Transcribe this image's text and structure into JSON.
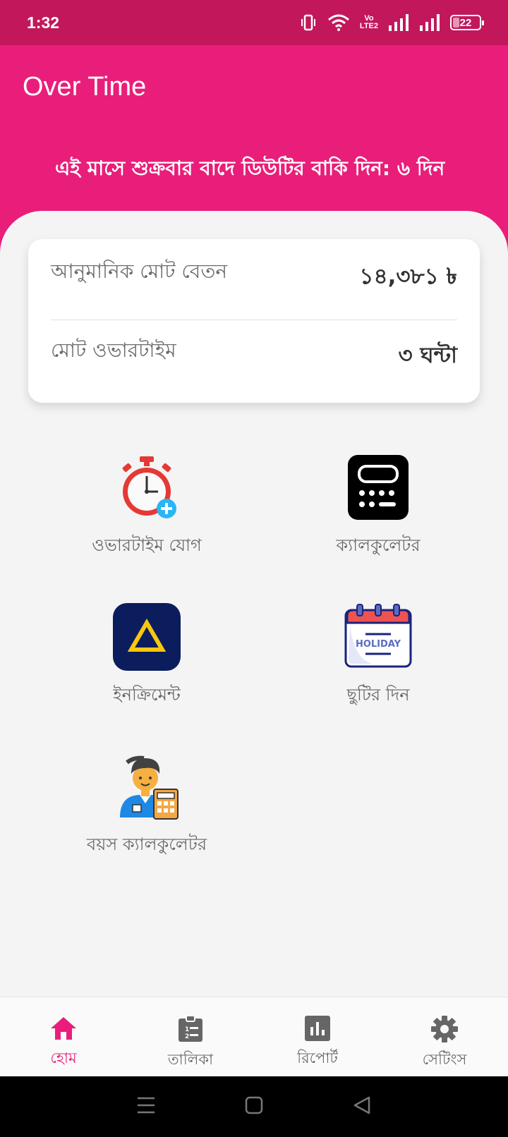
{
  "status_bar": {
    "time": "1:32",
    "network_label_top": "Vo",
    "network_label_bottom": "LTE2",
    "battery_level": "22"
  },
  "header": {
    "title": "Over Time",
    "marquee": "এই মাসে শুক্রবার বাদে ডিউটির বাকি দিন: ৬ দিন"
  },
  "summary": {
    "salary_label": "আনুমানিক মোট বেতন",
    "salary_value": "১৪,৩৮১ ৳",
    "overtime_label": "মোট ওভারটাইম",
    "overtime_value": "৩ ঘন্টা"
  },
  "features": [
    {
      "label": "ওভারটাইম যোগ",
      "icon": "stopwatch-add-icon"
    },
    {
      "label": "ক্যালকুলেটর",
      "icon": "calculator-icon"
    },
    {
      "label": "ইনক্রিমেন্ট",
      "icon": "increment-triangle-icon"
    },
    {
      "label": "ছুটির দিন",
      "icon": "holiday-calendar-icon"
    },
    {
      "label": "বয়স ক্যালকুলেটর",
      "icon": "person-calculator-icon"
    }
  ],
  "holiday_badge": "HOLIDAY",
  "bottom_nav": [
    {
      "label": "হোম",
      "icon": "home-icon",
      "active": true
    },
    {
      "label": "তালিকা",
      "icon": "clipboard-list-icon",
      "active": false
    },
    {
      "label": "রিপোর্ট",
      "icon": "bar-chart-icon",
      "active": false
    },
    {
      "label": "সেটিংস",
      "icon": "gear-icon",
      "active": false
    }
  ],
  "colors": {
    "status_bar": "#c2185b",
    "primary": "#e91e7a",
    "background": "#f4f4f4"
  }
}
